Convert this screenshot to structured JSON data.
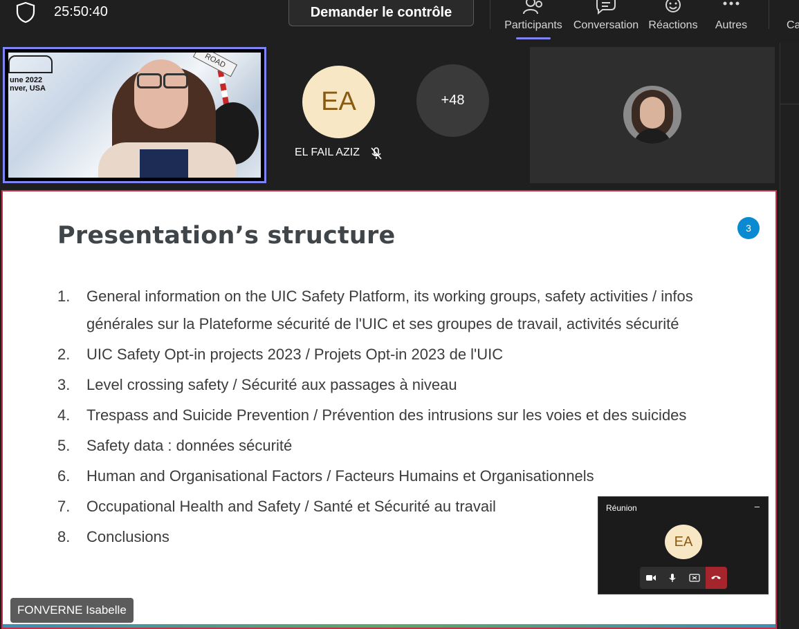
{
  "toolbar": {
    "timer": "25:50:40",
    "request_control": "Demander le contrôle",
    "participants": "Participants",
    "conversation": "Conversation",
    "reactions": "Réactions",
    "more": "Autres",
    "camera_partial": "Ca"
  },
  "video_tile": {
    "overlay_line1": "une 2022",
    "overlay_line2": "nver, USA",
    "sign_text": "ROAD"
  },
  "participants": {
    "el_fail_initials": "EA",
    "el_fail_name": "EL FAIL AZIZ",
    "more_count": "+48"
  },
  "slide": {
    "title": "Presentation’s structure",
    "page_number": "3",
    "items": [
      {
        "num": "1.",
        "text": "General information on the UIC Safety Platform, its working groups, safety activities / infos générales sur la Plateforme sécurité de l'UIC et ses groupes de travail, activités sécurité"
      },
      {
        "num": "2.",
        "text": "UIC Safety Opt-in projects 2023 / Projets Opt-in 2023 de l'UIC"
      },
      {
        "num": "3.",
        "text": "Level crossing safety / Sécurité aux passages à niveau"
      },
      {
        "num": "4.",
        "text": "Trespass and Suicide Prevention / Prévention des intrusions sur les voies et des suicides"
      },
      {
        "num": "5.",
        "text": "Safety data : données sécurité"
      },
      {
        "num": "6.",
        "text": "Human and Organisational Factors / Facteurs Humains et Organisationnels"
      },
      {
        "num": "7.",
        "text": "Occupational Health and Safety / Santé et Sécurité au travail"
      },
      {
        "num": "8.",
        "text": "Conclusions"
      }
    ]
  },
  "presenter": {
    "name": "FONVERNE Isabelle"
  },
  "mini_window": {
    "title": "Réunion",
    "minimize": "–",
    "initials": "EA"
  },
  "icons": [
    "shield-icon",
    "participants-icon",
    "chat-icon",
    "reactions-icon",
    "more-icon",
    "mic-off-icon",
    "video-icon",
    "mic-icon",
    "share-icon",
    "hangup-icon"
  ],
  "colors": {
    "accent": "#7f85f5",
    "presenter_border": "#c4314b",
    "hangup": "#a4262c",
    "badge": "#0a8ad1"
  }
}
